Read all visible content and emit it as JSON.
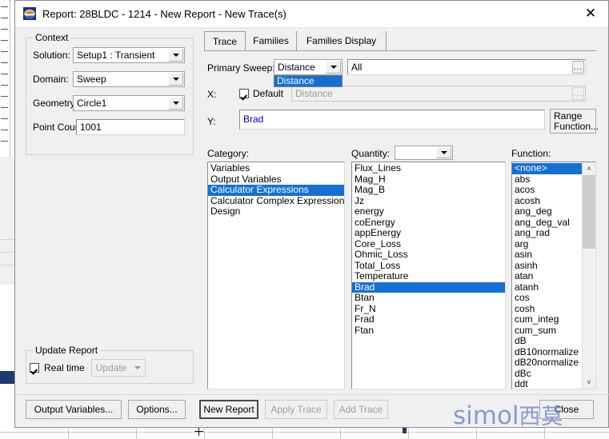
{
  "window": {
    "title": "Report: 28BLDC - 1214 - New Report - New Trace(s)",
    "icon": "report-plot-icon",
    "close_label": "✕"
  },
  "context": {
    "group_title": "Context",
    "solution_label": "Solution:",
    "solution_value": "Setup1 : Transient",
    "domain_label": "Domain:",
    "domain_value": "Sweep",
    "geometry_label": "Geometry:",
    "geometry_value": "Circle1",
    "point_count_label": "Point Count:",
    "point_count_value": "1001"
  },
  "update_report": {
    "group_title": "Update Report",
    "realtime_label": "Real time",
    "realtime_checked": true,
    "update_label": "Update"
  },
  "left_buttons": {
    "output_variables": "Output Variables...",
    "options": "Options..."
  },
  "tabs": [
    {
      "label": "Trace",
      "active": true
    },
    {
      "label": "Families",
      "active": false
    },
    {
      "label": "Families Display",
      "active": false
    }
  ],
  "trace": {
    "primary_sweep_label": "Primary Sweep:",
    "primary_sweep_value": "Distance",
    "primary_sweep_options": [
      "Distance"
    ],
    "primary_sweep_selected_index": 0,
    "sweep_range_value": "All",
    "sweep_range_dots": "...",
    "x_label": "X:",
    "x_default_label": "Default",
    "x_default_checked": true,
    "x_value": "Distance",
    "x_dots": "...",
    "y_label": "Y:",
    "y_value": "Brad",
    "range_function_label_line1": "Range",
    "range_function_label_line2": "Function..."
  },
  "category": {
    "label": "Category:",
    "items": [
      "Variables",
      "Output Variables",
      "Calculator Expressions",
      "Calculator Complex Expressions",
      "Design"
    ],
    "selected_index": 2
  },
  "quantity": {
    "label": "Quantity:",
    "combo_value": "",
    "items": [
      "Flux_Lines",
      "Mag_H",
      "Mag_B",
      "Jz",
      "energy",
      "coEnergy",
      "appEnergy",
      "Core_Loss",
      "Ohmic_Loss",
      "Total_Loss",
      "Temperature",
      "Brad",
      "Btan",
      "Fr_N",
      "Frad",
      "Ftan"
    ],
    "selected_index": 11
  },
  "function": {
    "label": "Function:",
    "items": [
      "<none>",
      "abs",
      "acos",
      "acosh",
      "ang_deg",
      "ang_deg_val",
      "ang_rad",
      "arg",
      "asin",
      "asinh",
      "atan",
      "atanh",
      "cos",
      "cosh",
      "cum_integ",
      "cum_sum",
      "dB",
      "dB10normalize",
      "dB20normalize",
      "dBc",
      "ddt"
    ],
    "selected_index": 0,
    "scroll_up": "˄",
    "scroll_down": "˅"
  },
  "bottom_buttons": {
    "new_report": "New Report",
    "apply_trace": "Apply Trace",
    "add_trace": "Add Trace",
    "close": "Close"
  },
  "watermark": {
    "latin": "simol",
    "cjk": "西莫"
  },
  "colors": {
    "selection_blue": "#1570d4",
    "dialog_face": "#f0f0f0",
    "field_text_blue": "#0000cc",
    "watermark": "#7f93cf"
  }
}
